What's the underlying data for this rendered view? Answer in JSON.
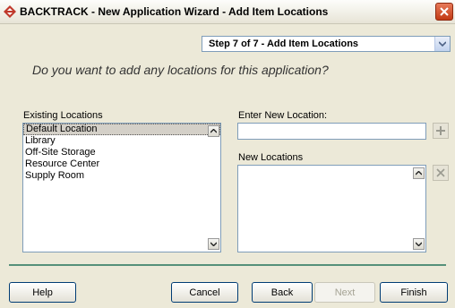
{
  "window": {
    "title": "BACKTRACK - New Application Wizard - Add Item Locations"
  },
  "step": {
    "selected": "Step 7 of 7 - Add Item Locations"
  },
  "question": "Do you want to add any locations for this application?",
  "existing_locations": {
    "label": "Existing Locations",
    "items": [
      "Default Location",
      "Library",
      "Off-Site Storage",
      "Resource Center",
      "Supply Room"
    ],
    "selected_index": 0
  },
  "new_location": {
    "label": "Enter New Location:",
    "value": ""
  },
  "new_locations": {
    "label": "New Locations",
    "items": []
  },
  "buttons": {
    "help": "Help",
    "cancel": "Cancel",
    "back": "Back",
    "next": "Next",
    "finish": "Finish"
  },
  "colors": {
    "divider": "#55907a",
    "button_border": "#003c74"
  }
}
